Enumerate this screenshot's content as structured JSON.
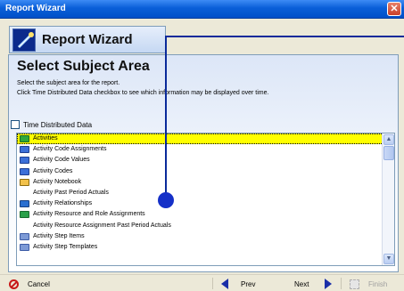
{
  "window": {
    "title": "Report Wizard",
    "close_glyph": "✕"
  },
  "header": {
    "title": "Report Wizard",
    "icon": "magic-wand-icon"
  },
  "panel": {
    "heading": "Select Subject Area",
    "instruction_1": "Select the subject area for the report.",
    "instruction_2": "Click Time Distributed Data checkbox to see which information may be displayed over time."
  },
  "time_distributed": {
    "label": "Time Distributed Data",
    "checked": false
  },
  "subject_list": {
    "items": [
      {
        "label": "Activities",
        "icon": "activity-icon",
        "selected": true
      },
      {
        "label": "Activity Code Assignments",
        "icon": "activity-code-icon"
      },
      {
        "label": "Activity Code Values",
        "icon": "activity-code-icon"
      },
      {
        "label": "Activity Codes",
        "icon": "activity-code-icon"
      },
      {
        "label": "Activity Notebook",
        "icon": "notebook-icon"
      },
      {
        "label": "Activity Past Period Actuals",
        "icon": ""
      },
      {
        "label": "Activity Relationships",
        "icon": "relationship-icon"
      },
      {
        "label": "Activity Resource and Role Assignments",
        "icon": "resource-icon"
      },
      {
        "label": "Activity Resource Assignment Past Period Actuals",
        "icon": ""
      },
      {
        "label": "Activity Step Items",
        "icon": "step-icon"
      },
      {
        "label": "Activity Step Templates",
        "icon": "step-icon"
      }
    ]
  },
  "footer": {
    "cancel_label": "Cancel",
    "prev_label": "Prev",
    "next_label": "Next",
    "finish_label": "Finish"
  },
  "colors": {
    "selection": "#ffff00",
    "title_bar": "#0a5fd8",
    "callout": "#1530c8"
  }
}
